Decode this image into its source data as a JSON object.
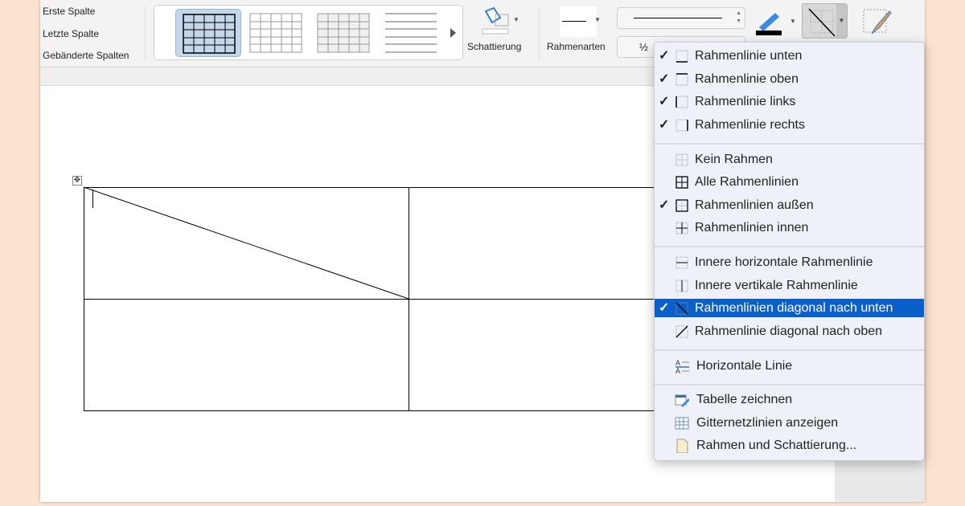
{
  "ribbon": {
    "options": [
      "Erste Spalte",
      "Letzte Spalte",
      "Gebänderte Spalten"
    ],
    "shading_label": "Schattierung",
    "border_styles_label": "Rahmenarten",
    "pen_weight": "½"
  },
  "colors": {
    "highlight": "#0b5fca",
    "pen": "#000000"
  },
  "menu": {
    "groups": [
      [
        {
          "label": "Rahmenlinie unten",
          "checked": true,
          "icon": "border-bottom-icon"
        },
        {
          "label": "Rahmenlinie oben",
          "checked": true,
          "icon": "border-top-icon"
        },
        {
          "label": "Rahmenlinie links",
          "checked": true,
          "icon": "border-left-icon"
        },
        {
          "label": "Rahmenlinie rechts",
          "checked": true,
          "icon": "border-right-icon"
        }
      ],
      [
        {
          "label": "Kein Rahmen",
          "checked": false,
          "icon": "no-border-icon"
        },
        {
          "label": "Alle Rahmenlinien",
          "checked": false,
          "icon": "all-borders-icon"
        },
        {
          "label": "Rahmenlinien außen",
          "checked": true,
          "icon": "outside-borders-icon"
        },
        {
          "label": "Rahmenlinien innen",
          "checked": false,
          "icon": "inside-borders-icon"
        }
      ],
      [
        {
          "label": "Innere horizontale Rahmenlinie",
          "checked": false,
          "icon": "inside-horizontal-border-icon"
        },
        {
          "label": "Innere vertikale Rahmenlinie",
          "checked": false,
          "icon": "inside-vertical-border-icon"
        },
        {
          "label": "Rahmenlinien diagonal nach unten",
          "checked": true,
          "highlighted": true,
          "icon": "diagonal-down-border-icon"
        },
        {
          "label": "Rahmenlinie diagonal nach oben",
          "checked": false,
          "icon": "diagonal-up-border-icon"
        }
      ],
      [
        {
          "label": "Horizontale Linie",
          "checked": false,
          "icon": "horizontal-line-icon"
        }
      ],
      [
        {
          "label": "Tabelle zeichnen",
          "checked": false,
          "icon": "draw-table-icon"
        },
        {
          "label": "Gitternetzlinien anzeigen",
          "checked": false,
          "icon": "gridlines-icon"
        },
        {
          "label": "Rahmen und Schattierung...",
          "checked": false,
          "icon": "borders-shading-icon"
        }
      ]
    ]
  }
}
